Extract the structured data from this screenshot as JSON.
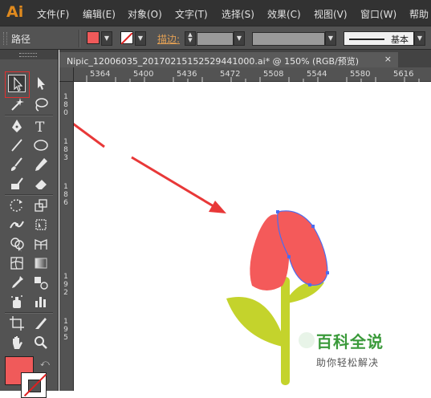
{
  "app": {
    "logo": "Ai"
  },
  "menu": [
    "文件(F)",
    "编辑(E)",
    "对象(O)",
    "文字(T)",
    "选择(S)",
    "效果(C)",
    "视图(V)",
    "窗口(W)",
    "帮助"
  ],
  "control_bar": {
    "selection_label": "路径",
    "stroke_label": "描边:",
    "profile_label": "基本",
    "fill_color": "#f05a5a"
  },
  "document_tab": {
    "title": "Nipic_12006035_20170215152529441000.ai* @ 150% (RGB/预览)",
    "close": "×"
  },
  "rulers": {
    "horizontal": [
      "5364",
      "5400",
      "5436",
      "5472",
      "5508",
      "5544",
      "5580",
      "5616"
    ],
    "vertical": [
      "1\n8\n0",
      "1\n8\n3",
      "1\n8\n6",
      "1\n9\n2",
      "1\n9\n5"
    ]
  },
  "tools": [
    {
      "name": "selection-tool",
      "active": true
    },
    {
      "name": "direct-selection-tool"
    },
    {
      "name": "magic-wand-tool"
    },
    {
      "name": "lasso-tool"
    },
    {
      "name": "pen-tool"
    },
    {
      "name": "type-tool"
    },
    {
      "name": "line-segment-tool"
    },
    {
      "name": "ellipse-tool"
    },
    {
      "name": "paintbrush-tool"
    },
    {
      "name": "pencil-tool"
    },
    {
      "name": "blob-brush-tool"
    },
    {
      "name": "eraser-tool"
    },
    {
      "name": "rotate-tool"
    },
    {
      "name": "scale-tool"
    },
    {
      "name": "width-tool"
    },
    {
      "name": "free-transform-tool"
    },
    {
      "name": "shape-builder-tool"
    },
    {
      "name": "perspective-grid-tool"
    },
    {
      "name": "mesh-tool"
    },
    {
      "name": "gradient-tool"
    },
    {
      "name": "eyedropper-tool"
    },
    {
      "name": "blend-tool"
    },
    {
      "name": "symbol-sprayer-tool"
    },
    {
      "name": "column-graph-tool"
    },
    {
      "name": "artboard-tool"
    },
    {
      "name": "slice-tool"
    },
    {
      "name": "hand-tool"
    },
    {
      "name": "zoom-tool"
    }
  ],
  "artwork": {
    "petal_color": "#f45a5a",
    "stem_color": "#c4d32c",
    "selection_color": "#4a6cf0",
    "arrow_color": "#e83838"
  },
  "watermark": {
    "title": "百科全说",
    "subtitle": "助你轻松解决"
  }
}
